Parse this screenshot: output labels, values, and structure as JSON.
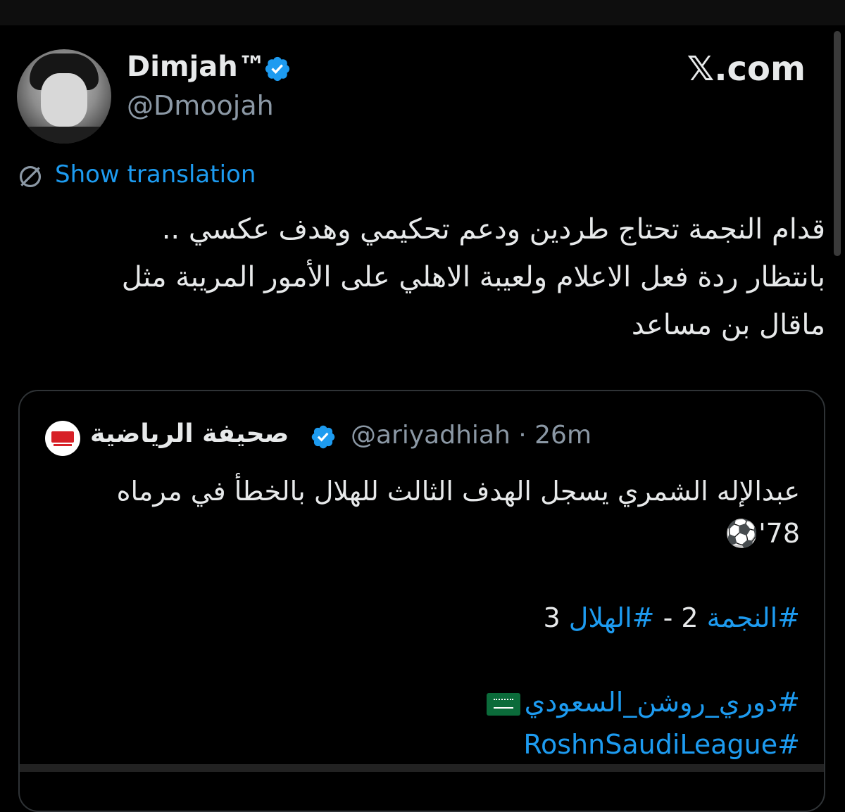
{
  "post": {
    "display_name": "Dimjah™",
    "handle": "@Dmoojah",
    "site_logo": "𝕏.com",
    "show_translation": "Show translation",
    "text_lines": [
      "قدام النجمة تحتاج طردين ودعم تحكيمي وهدف عكسي ..",
      "بانتظار ردة فعل الاعلام ولعيبة الاهلي على الأمور المريبة مثل",
      "ماقال بن مساعد"
    ]
  },
  "quote": {
    "name": "صحيفة الرياضية",
    "handle": "@ariyadhiah",
    "separator": "·",
    "time": "26m",
    "line1": "عبدالإله الشمري يسجل الهدف الثالث للهلال بالخطأ في مرماه",
    "line2_minute": "78'",
    "line2_emoji": "⚽",
    "score_tag1": "#النجمة",
    "score_mid": " 2 - ",
    "score_tag2": "#الهلال",
    "score_end": " 3",
    "league_tag_ar": "#دوري_روشن_السعودي",
    "league_tag_en": "#RoshnSaudiLeague"
  },
  "icons": {
    "verified": "verified-badge-icon",
    "translate": "translate-icon"
  },
  "colors": {
    "background": "#000000",
    "text": "#e7e9ea",
    "muted": "#8b98a5",
    "link": "#1d9bf0",
    "border": "#2f3336"
  }
}
